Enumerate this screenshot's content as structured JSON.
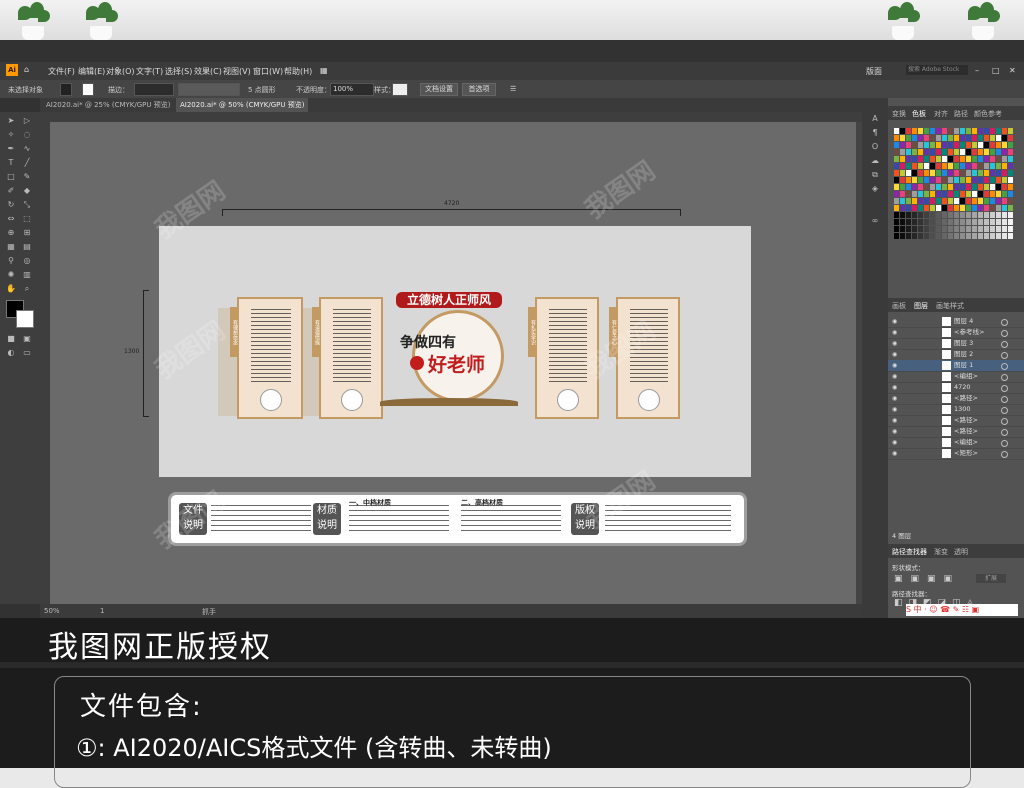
{
  "app": {
    "logo": "Ai",
    "menu": [
      "文件(F)",
      "编辑(E)",
      "对象(O)",
      "文字(T)",
      "选择(S)",
      "效果(C)",
      "视图(V)",
      "窗口(W)",
      "帮助(H)"
    ],
    "workspace": "版面",
    "search_placeholder": "搜索 Adobe Stock"
  },
  "control_bar": {
    "selection": "未选择对象",
    "stroke_label": "描边：",
    "points_label": "5 点圆形",
    "opacity_label": "不透明度：",
    "opacity_value": "100%",
    "style_label": "样式：",
    "doc_setup": "文档设置",
    "preferences": "首选项"
  },
  "tabs": [
    {
      "label": "AI2020.ai* @ 25% (CMYK/GPU 预览)"
    },
    {
      "label": "AI2020.ai* @ 50% (CMYK/GPU 预览)"
    }
  ],
  "status": {
    "zoom": "50%",
    "page": "1",
    "tool": "抓手"
  },
  "panels": {
    "color_tabs": [
      "变换",
      "色板",
      "对齐",
      "路径",
      "颜色参考"
    ],
    "layer_tabs": [
      "画板",
      "图层",
      "画笔样式"
    ],
    "layers": [
      {
        "name": "图层 4"
      },
      {
        "name": "<参考线>"
      },
      {
        "name": "图层 3"
      },
      {
        "name": "图层 2"
      },
      {
        "name": "图层 1"
      },
      {
        "name": "<编组>"
      },
      {
        "name": "4720"
      },
      {
        "name": "<路径>"
      },
      {
        "name": "1300"
      },
      {
        "name": "<路径>"
      },
      {
        "name": "<路径>"
      },
      {
        "name": "<编组>"
      },
      {
        "name": "<矩形>"
      }
    ],
    "layer_count": "4 图层",
    "path_tabs": [
      "路径查找器",
      "渐变",
      "透明"
    ],
    "shape_modes": "形状模式：",
    "pathfinder": "路径查找器：",
    "expand": "扩展"
  },
  "artwork": {
    "dim_width": "4720",
    "dim_height": "1300",
    "banner": "立德树人正师风",
    "line1": "争做四有",
    "line2": "好老师",
    "tags": [
      "有理想信念",
      "有道德情操",
      "有扎实学识",
      "有仁爱之心"
    ],
    "info": {
      "badge1": "文件说明",
      "badge2": "材质说明",
      "mid_grade": "一、中档材质",
      "high_grade": "二、高档材质",
      "badge3": "版权说明"
    }
  },
  "watermark": "我图网",
  "footer": {
    "heading": "我图网正版授权",
    "contains": "文件包含:",
    "item1": "①: AI2020/AICS格式文件 (含转曲、未转曲)"
  }
}
